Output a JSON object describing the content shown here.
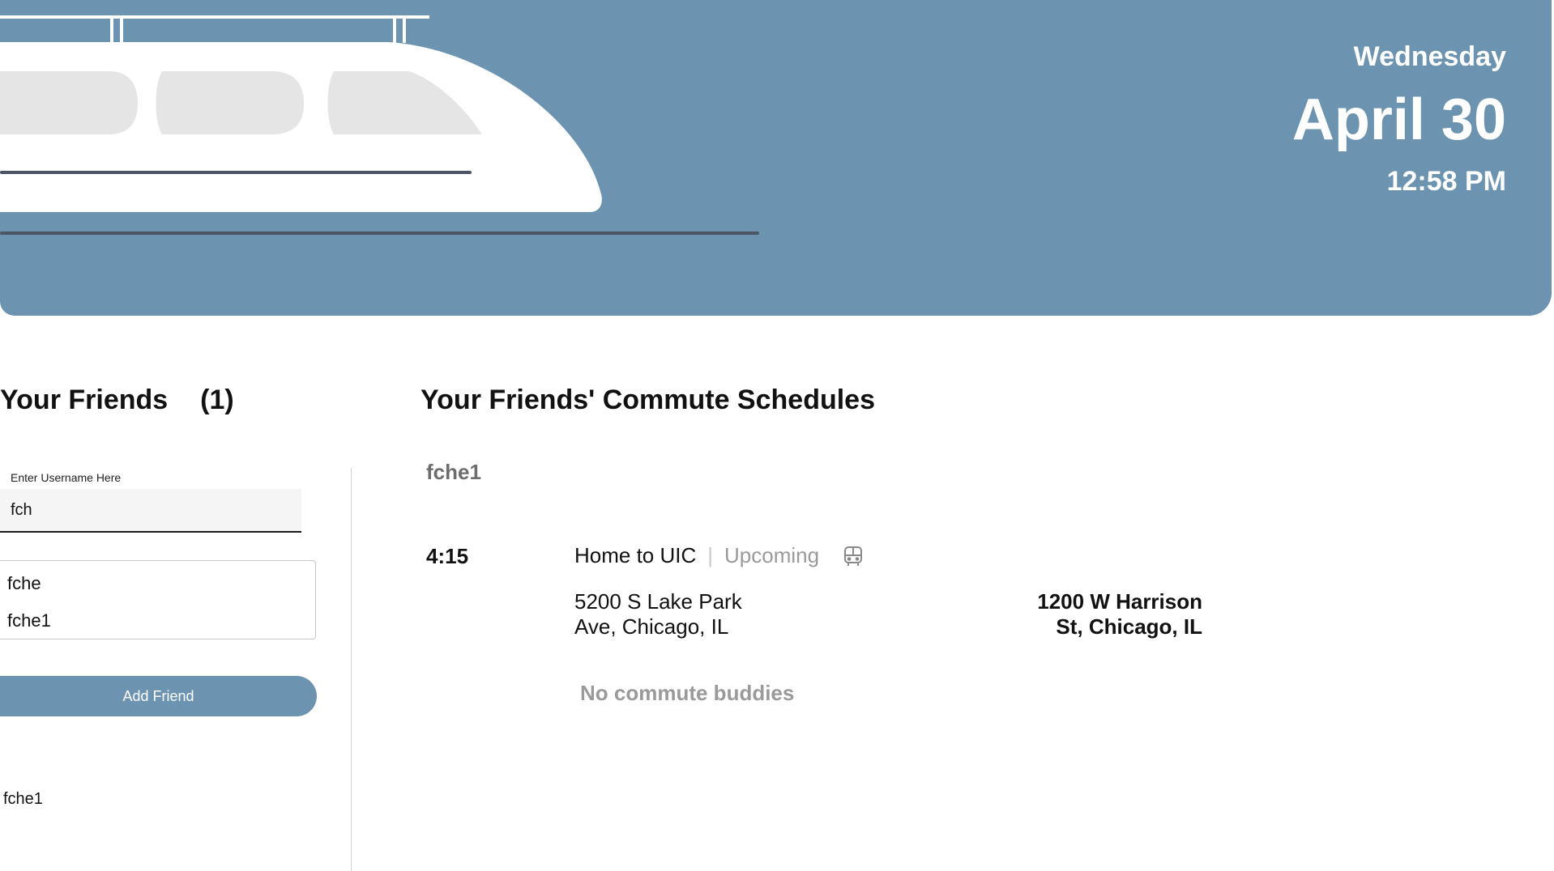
{
  "header": {
    "weekday": "Wednesday",
    "date": "April 30",
    "time": "12:58 PM",
    "banner_color": "#6c94b0"
  },
  "friends_panel": {
    "title": "Your Friends",
    "count": "(1)",
    "username_label": "Enter Username Here",
    "username_value": "fch",
    "suggestions": [
      "fche",
      "fche1"
    ],
    "add_button_label": "Add Friend",
    "friends": [
      "fche1"
    ]
  },
  "schedules": {
    "title": "Your Friends' Commute Schedules",
    "entries": [
      {
        "friend": "fche1",
        "time": "4:15",
        "route": "Home to UIC",
        "status": "Upcoming",
        "mode_icon": "bus-icon",
        "origin_line1": "5200 S Lake Park",
        "origin_line2": "Ave, Chicago, IL",
        "destination_line1": "1200 W Harrison",
        "destination_line2": "St, Chicago, IL",
        "buddies": "No commute buddies"
      }
    ]
  }
}
